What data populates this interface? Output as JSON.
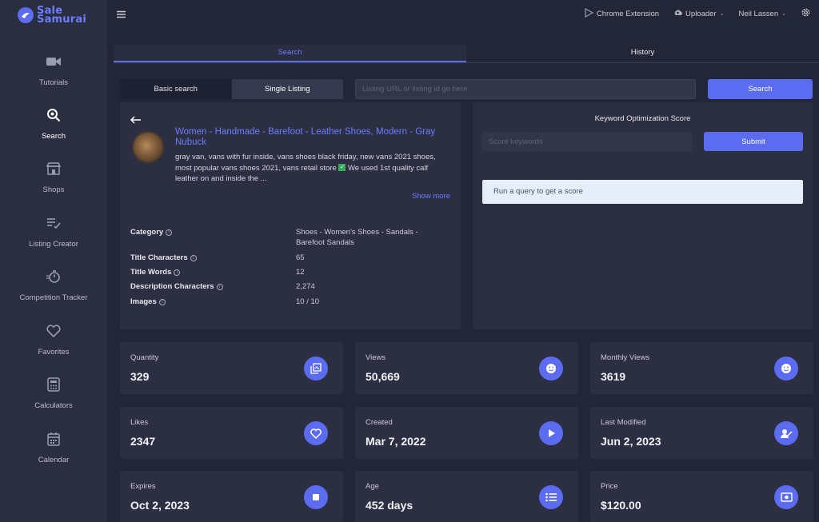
{
  "brand": {
    "line1": "Sale",
    "line2": "Samurai"
  },
  "sidebar": {
    "items": [
      {
        "label": "Tutorials",
        "icon": "video-camera-icon"
      },
      {
        "label": "Search",
        "icon": "search-icon",
        "active": true
      },
      {
        "label": "Shops",
        "icon": "shop-icon"
      },
      {
        "label": "Listing Creator",
        "icon": "list-edit-icon"
      },
      {
        "label": "Competition Tracker",
        "icon": "stopwatch-icon"
      },
      {
        "label": "Favorites",
        "icon": "heart-icon"
      },
      {
        "label": "Calculators",
        "icon": "calculator-icon"
      },
      {
        "label": "Calendar",
        "icon": "calendar-icon"
      }
    ]
  },
  "topbar": {
    "chrome_extension": "Chrome Extension",
    "uploader": "Uploader",
    "user": "Neil Lassen"
  },
  "tabs": {
    "search": "Search",
    "history": "History"
  },
  "search": {
    "basic": "Basic search",
    "single": "Single Listing",
    "placeholder": "Listing URL or listing id go here",
    "button": "Search"
  },
  "listing": {
    "title": "Women - Handmade - Barefoot - Leather Shoes, Modern - Gray Nubuck",
    "description_a": "gray van, vans with fur inside, vans shoes black friday, new vans 2021 shoes, most popular vans shoes 2021, vans retail store ",
    "check": "✓",
    "description_b": " We used 1st quality calf leather on and inside the ...",
    "show_more": "Show more",
    "info": [
      {
        "label": "Category",
        "value": "Shoes - Women's Shoes - Sandals - Barefoot Sandals"
      },
      {
        "label": "Title Characters",
        "value": "65"
      },
      {
        "label": "Title Words",
        "value": "12"
      },
      {
        "label": "Description Characters",
        "value": "2,274"
      },
      {
        "label": "Images",
        "value": "10 / 10"
      }
    ]
  },
  "keyword": {
    "title": "Keyword Optimization Score",
    "placeholder": "Score keywords",
    "submit": "Submit",
    "result": "Run a query to get a score"
  },
  "stats": [
    {
      "label": "Quantity",
      "value": "329",
      "icon": "inventory-icon"
    },
    {
      "label": "Views",
      "value": "50,669",
      "icon": "smiley-icon"
    },
    {
      "label": "Monthly Views",
      "value": "3619",
      "icon": "smiley-icon"
    },
    {
      "label": "Likes",
      "value": "2347",
      "icon": "heart-icon"
    },
    {
      "label": "Created",
      "value": "Mar 7, 2022",
      "icon": "play-icon"
    },
    {
      "label": "Last Modified",
      "value": "Jun 2, 2023",
      "icon": "user-edit-icon"
    },
    {
      "label": "Expires",
      "value": "Oct 2, 2023",
      "icon": "stop-icon"
    },
    {
      "label": "Age",
      "value": "452 days",
      "icon": "list-icon"
    },
    {
      "label": "Price",
      "value": "$120.00",
      "icon": "money-icon"
    }
  ],
  "colors": {
    "accent": "#5b6cf0",
    "background": "#232637",
    "panel": "#2c2f42"
  }
}
